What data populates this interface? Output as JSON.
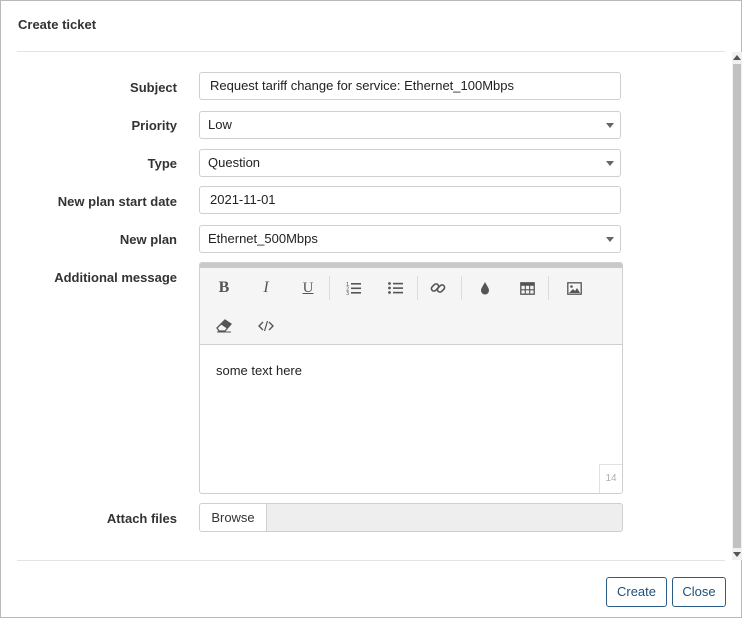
{
  "dialog": {
    "title": "Create ticket"
  },
  "form": {
    "subject": {
      "label": "Subject",
      "value": "Request tariff change for service: Ethernet_100Mbps"
    },
    "priority": {
      "label": "Priority",
      "value": "Low"
    },
    "type": {
      "label": "Type",
      "value": "Question"
    },
    "start_date": {
      "label": "New plan start date",
      "value": "2021-11-01"
    },
    "new_plan": {
      "label": "New plan",
      "value": "Ethernet_500Mbps"
    },
    "message": {
      "label": "Additional message",
      "text": "some text here",
      "char_count": "14",
      "toolbar_icons": [
        "bold-icon",
        "italic-icon",
        "underline-icon",
        "ordered-list-icon",
        "unordered-list-icon",
        "link-icon",
        "color-icon",
        "table-icon",
        "image-icon",
        "eraser-icon",
        "code-view-icon"
      ]
    },
    "attach": {
      "label": "Attach files",
      "browse_label": "Browse"
    }
  },
  "footer": {
    "create_label": "Create",
    "close_label": "Close"
  },
  "colors": {
    "primary_border": "#2a5d8a",
    "primary_text": "#1f4f7a"
  }
}
